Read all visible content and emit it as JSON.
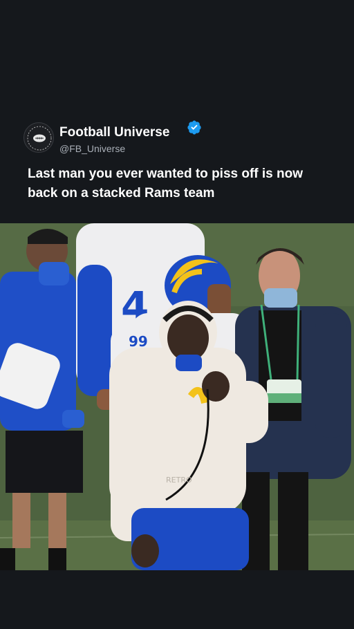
{
  "post": {
    "author_name": "Football Universe",
    "handle": "@FB_Universe",
    "text": "Last man you ever wanted to piss off is now back on a stacked Rams team",
    "avatar_logo_text": "FOOTBALL UNIVERSE"
  },
  "media": {
    "jersey_numbers": [
      "4",
      "99"
    ],
    "brand_mark": "RETRO"
  },
  "colors": {
    "background": "#15181c",
    "verified": "#1d9bf0",
    "rams_blue": "#1c4bc4",
    "rams_gold": "#f3c21a",
    "field_green": "#4b5f3b"
  },
  "icons": [
    "verified-badge-icon",
    "avatar-logo"
  ]
}
